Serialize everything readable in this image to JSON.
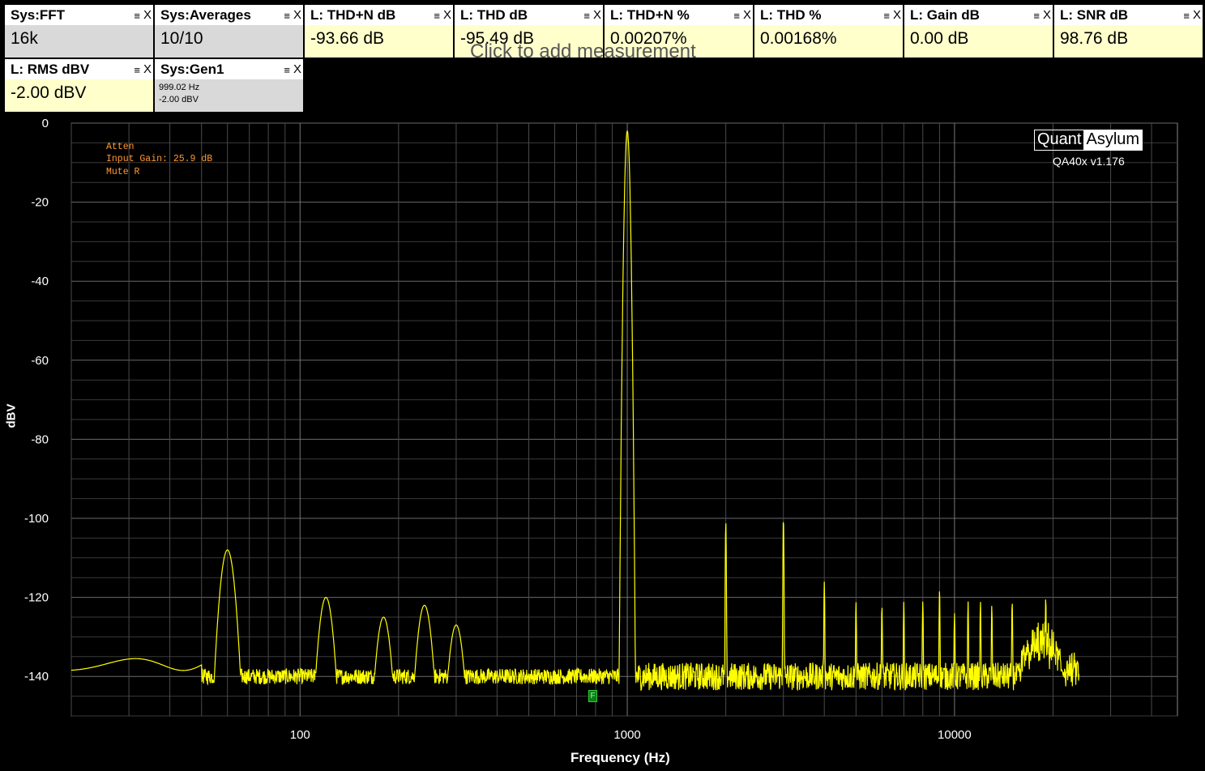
{
  "tiles": [
    {
      "title": "Sys:FFT",
      "value": "16k",
      "kind": "sys"
    },
    {
      "title": "Sys:Averages",
      "value": "10/10",
      "kind": "sys"
    },
    {
      "title": "L: THD+N dB",
      "value": "-93.66 dB",
      "kind": "meas"
    },
    {
      "title": "L: THD dB",
      "value": "-95.49 dB",
      "kind": "meas"
    },
    {
      "title": "L: THD+N %",
      "value": "0.00207%",
      "kind": "meas"
    },
    {
      "title": "L: THD %",
      "value": "0.00168%",
      "kind": "meas"
    },
    {
      "title": "L: Gain dB",
      "value": "0.00 dB",
      "kind": "meas"
    },
    {
      "title": "L: SNR dB",
      "value": "98.76 dB",
      "kind": "meas"
    },
    {
      "title": "L: RMS dBV",
      "value": "-2.00 dBV",
      "kind": "meas"
    },
    {
      "title": "Sys:Gen1",
      "line1": "999.02 Hz",
      "line2": "-2.00 dBV",
      "kind": "sys"
    }
  ],
  "tile_icons": {
    "menu": "≡",
    "close": "X"
  },
  "add_measurement_hint": "Click to add measurement",
  "annotations": [
    "Atten",
    "Input Gain: 25.9 dB",
    "Mute R"
  ],
  "logo": {
    "left": "Quant",
    "right": "Asylum"
  },
  "version": "QA40x v1.176",
  "fundamental_marker": "F",
  "colors": {
    "trace": "#ffff00",
    "annotation": "#ff9933",
    "grid": "#5a5a5a",
    "tile_measure": "#ffffcc",
    "tile_system": "#d9d9d9"
  },
  "chart_data": {
    "type": "line",
    "xlabel": "Frequency (Hz)",
    "ylabel": "dBV",
    "xscale": "log",
    "xlim": [
      20,
      48000
    ],
    "ylim": [
      -150,
      0
    ],
    "xticks": [
      100,
      1000,
      10000
    ],
    "yticks": [
      0,
      -20,
      -40,
      -60,
      -80,
      -100,
      -120,
      -140
    ],
    "grid": true,
    "fundamental_hz": 1000,
    "fundamental_dbv": -2.0,
    "noise_floor_dbv": -140,
    "peaks": [
      {
        "x": 60,
        "y": -108
      },
      {
        "x": 120,
        "y": -120
      },
      {
        "x": 180,
        "y": -125
      },
      {
        "x": 240,
        "y": -122
      },
      {
        "x": 300,
        "y": -127
      },
      {
        "x": 1000,
        "y": -2
      },
      {
        "x": 2000,
        "y": -101
      },
      {
        "x": 3000,
        "y": -100
      },
      {
        "x": 4000,
        "y": -116
      },
      {
        "x": 5000,
        "y": -121
      },
      {
        "x": 6000,
        "y": -122
      },
      {
        "x": 7000,
        "y": -121
      },
      {
        "x": 8000,
        "y": -121
      },
      {
        "x": 9000,
        "y": -118
      },
      {
        "x": 10000,
        "y": -124
      },
      {
        "x": 11000,
        "y": -121
      },
      {
        "x": 12000,
        "y": -121
      },
      {
        "x": 13000,
        "y": -122
      },
      {
        "x": 15000,
        "y": -121
      },
      {
        "x": 19000,
        "y": -120
      }
    ],
    "x_end_hz": 24000
  }
}
